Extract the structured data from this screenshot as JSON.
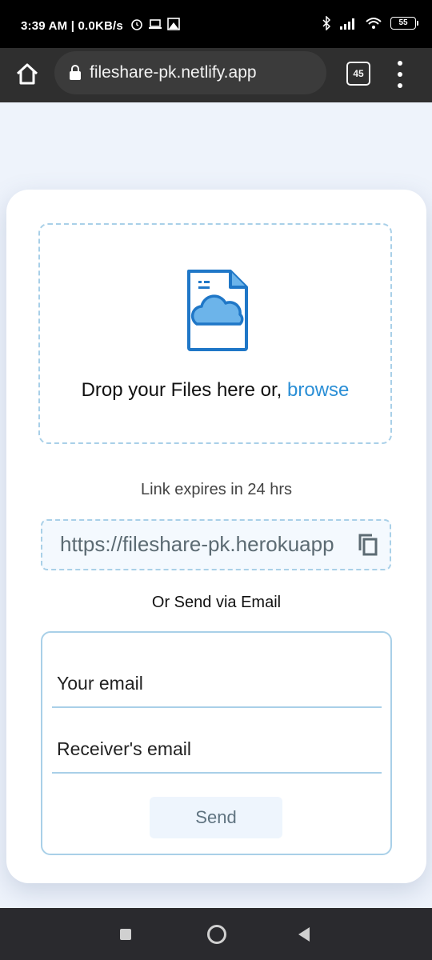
{
  "status_bar": {
    "time_speed": "3:39 AM | 0.0KB/s",
    "battery": "55"
  },
  "browser": {
    "url": "fileshare-pk.netlify.app",
    "tab_count": "45"
  },
  "upload": {
    "drop_text": "Drop your Files here or,",
    "browse_label": "browse"
  },
  "share": {
    "expires_text": "Link expires in 24 hrs",
    "link_value": "https://fileshare-pk.herokuapp",
    "or_send_text": "Or Send via Email"
  },
  "email_form": {
    "your_email_placeholder": "Your email",
    "receiver_email_placeholder": "Receiver's email",
    "send_label": "Send"
  },
  "colors": {
    "accent": "#2b8fd6",
    "border": "#a9d0e8",
    "cloud_fill": "#6cb4ea"
  },
  "icons": [
    "home-icon",
    "lock-icon",
    "tabs-icon",
    "menu-icon",
    "file-upload-icon",
    "copy-icon",
    "recents-icon",
    "home-nav-icon",
    "back-icon"
  ]
}
